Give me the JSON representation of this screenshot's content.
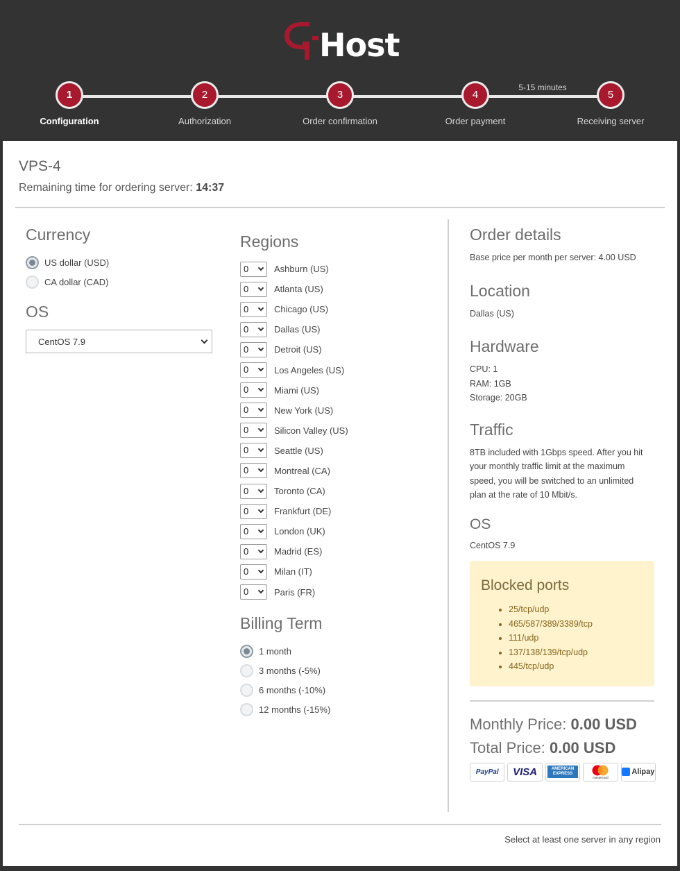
{
  "brand": {
    "logo_text": "Host",
    "accent": "#a8192e"
  },
  "steps": [
    {
      "number": "1",
      "label": "Configuration",
      "active": true
    },
    {
      "number": "2",
      "label": "Authorization"
    },
    {
      "number": "3",
      "label": "Order confirmation"
    },
    {
      "number": "4",
      "label": "Order payment"
    },
    {
      "number": "5",
      "label": "Receiving server"
    }
  ],
  "step_note": "5-15 minutes",
  "product": {
    "name": "VPS-4",
    "remaining_label": "Remaining time for ordering server:",
    "remaining_time": "14:37"
  },
  "currency": {
    "title": "Currency",
    "options": [
      {
        "label": "US dollar (USD)",
        "checked": true
      },
      {
        "label": "CA dollar (CAD)",
        "checked": false
      }
    ]
  },
  "os": {
    "title": "OS",
    "selected": "CentOS 7.9"
  },
  "regions": {
    "title": "Regions",
    "items": [
      {
        "qty": "0",
        "label": "Ashburn (US)"
      },
      {
        "qty": "0",
        "label": "Atlanta (US)"
      },
      {
        "qty": "0",
        "label": "Chicago (US)"
      },
      {
        "qty": "0",
        "label": "Dallas (US)"
      },
      {
        "qty": "0",
        "label": "Detroit (US)"
      },
      {
        "qty": "0",
        "label": "Los Angeles (US)"
      },
      {
        "qty": "0",
        "label": "Miami (US)"
      },
      {
        "qty": "0",
        "label": "New York (US)"
      },
      {
        "qty": "0",
        "label": "Silicon Valley (US)"
      },
      {
        "qty": "0",
        "label": "Seattle (US)"
      },
      {
        "qty": "0",
        "label": "Montreal (CA)"
      },
      {
        "qty": "0",
        "label": "Toronto (CA)"
      },
      {
        "qty": "0",
        "label": "Frankfurt (DE)"
      },
      {
        "qty": "0",
        "label": "London (UK)"
      },
      {
        "qty": "0",
        "label": "Madrid (ES)"
      },
      {
        "qty": "0",
        "label": "Milan (IT)"
      },
      {
        "qty": "0",
        "label": "Paris (FR)"
      }
    ]
  },
  "billing": {
    "title": "Billing Term",
    "options": [
      {
        "label": "1 month",
        "checked": true
      },
      {
        "label": "3 months (-5%)",
        "checked": false
      },
      {
        "label": "6 months (-10%)",
        "checked": false
      },
      {
        "label": "12 months (-15%)",
        "checked": false
      }
    ]
  },
  "order": {
    "title": "Order details",
    "base_price": "Base price per month per server: 4.00 USD",
    "location_title": "Location",
    "location": "Dallas (US)",
    "hardware_title": "Hardware",
    "cpu": "CPU: 1",
    "ram": "RAM: 1GB",
    "storage": "Storage: 20GB",
    "traffic_title": "Traffic",
    "traffic_text": "8TB included with 1Gbps speed. After you hit your monthly traffic limit at the maximum speed, you will be switched to an unlimited plan at the rate of 10 Mbit/s.",
    "os_title": "OS",
    "os_value": "CentOS 7.9",
    "blocked_title": "Blocked ports",
    "blocked_ports": [
      "25/tcp/udp",
      "465/587/389/3389/tcp",
      "111/udp",
      "137/138/139/tcp/udp",
      "445/tcp/udp"
    ],
    "monthly_label": "Monthly Price:",
    "monthly_value": "0.00 USD",
    "total_label": "Total Price:",
    "total_value": "0.00 USD",
    "payment_methods": [
      {
        "name": "paypal-icon",
        "text": "PayPal"
      },
      {
        "name": "visa-icon",
        "text": "VISA"
      },
      {
        "name": "amex-icon",
        "text": "AMERICAN EXPRESS"
      },
      {
        "name": "mastercard-icon",
        "text": "mastercard"
      },
      {
        "name": "alipay-icon",
        "text": "Alipay"
      }
    ]
  },
  "footer_note": "Select at least one server in any region"
}
